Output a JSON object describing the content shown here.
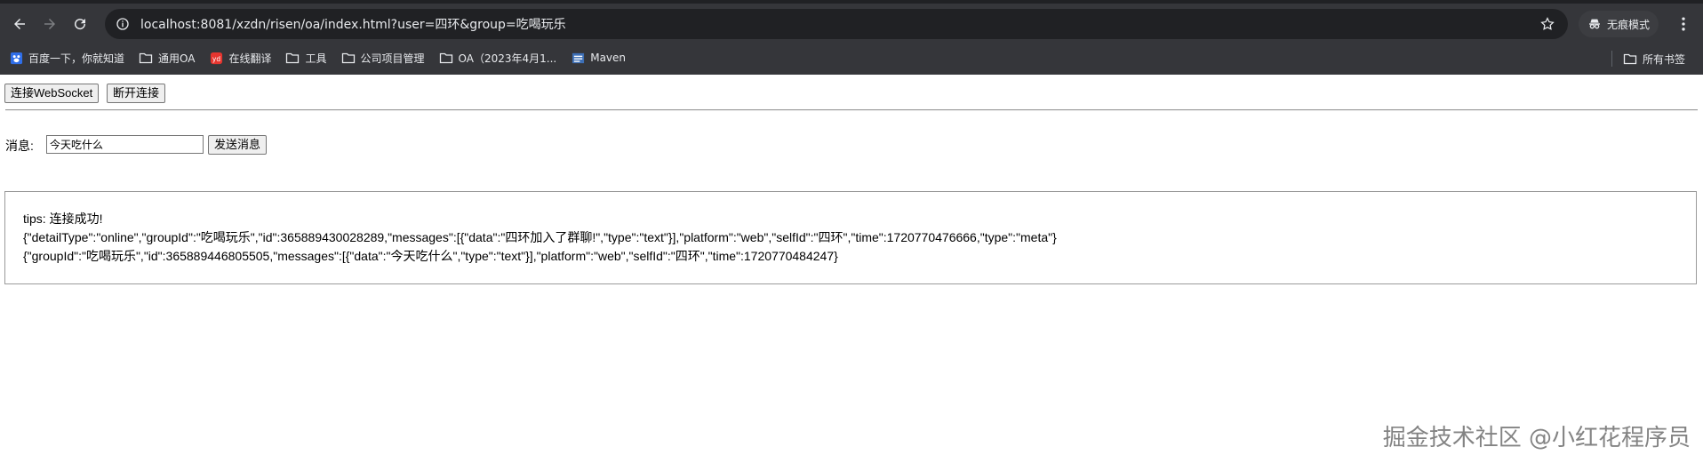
{
  "browser": {
    "url": "localhost:8081/xzdn/risen/oa/index.html?user=四环&group=吃喝玩乐",
    "incognito_label": "无痕模式",
    "bookmarks": [
      {
        "label": "百度一下，你就知道",
        "icon": "baidu-icon"
      },
      {
        "label": "通用OA",
        "icon": "folder-icon"
      },
      {
        "label": "在线翻译",
        "icon": "youdao-icon"
      },
      {
        "label": "工具",
        "icon": "folder-icon"
      },
      {
        "label": "公司项目管理",
        "icon": "folder-icon"
      },
      {
        "label": "OA（2023年4月1...",
        "icon": "folder-icon"
      },
      {
        "label": "Maven",
        "icon": "maven-icon"
      }
    ],
    "all_bookmarks_label": "所有书签"
  },
  "page": {
    "connect_button": "连接WebSocket",
    "disconnect_button": "断开连接",
    "message_label": "消息:",
    "message_input_value": "今天吃什么",
    "send_button": "发送消息",
    "log_lines": [
      "tips: 连接成功!",
      "{\"detailType\":\"online\",\"groupId\":\"吃喝玩乐\",\"id\":365889430028289,\"messages\":[{\"data\":\"四环加入了群聊!\",\"type\":\"text\"}],\"platform\":\"web\",\"selfId\":\"四环\",\"time\":1720770476666,\"type\":\"meta\"}",
      "{\"groupId\":\"吃喝玩乐\",\"id\":365889446805505,\"messages\":[{\"data\":\"今天吃什么\",\"type\":\"text\"}],\"platform\":\"web\",\"selfId\":\"四环\",\"time\":1720770484247}"
    ]
  },
  "watermark": "掘金技术社区 @小红花程序员"
}
